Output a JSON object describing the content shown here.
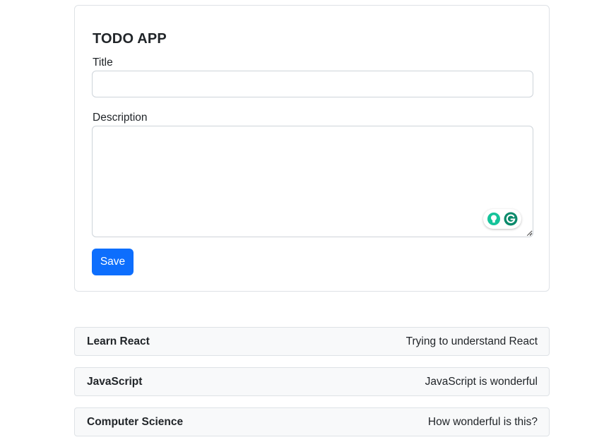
{
  "form": {
    "heading": "TODO APP",
    "title_label": "Title",
    "title_value": "",
    "description_label": "Description",
    "description_value": "",
    "save_label": "Save"
  },
  "colors": {
    "primary": "#0d6efd",
    "grammarly_green": "#15c39a",
    "grammarly_dark": "#0b8a6b",
    "list_bg": "#f8f9fa",
    "border": "#dee2e6"
  },
  "icons": {
    "grammarly_bulb": "lightbulb-icon",
    "grammarly_logo": "grammarly-g-icon",
    "resize": "resize-grip-icon"
  },
  "todos": [
    {
      "title": "Learn React",
      "description": "Trying to understand React"
    },
    {
      "title": "JavaScript",
      "description": "JavaScript is wonderful"
    },
    {
      "title": "Computer Science",
      "description": "How wonderful is this?"
    }
  ]
}
